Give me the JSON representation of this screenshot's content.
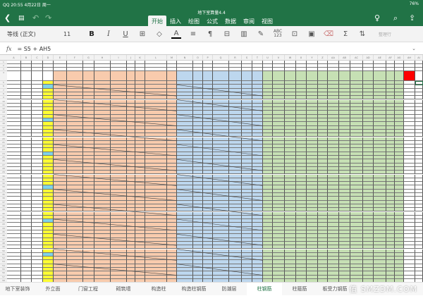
{
  "status_bar": {
    "left": "QQ 20:55 4月22日 周一",
    "right": "76%"
  },
  "window": {
    "title": "地下室算量4.4"
  },
  "ribbon": {
    "tabs": [
      "开始",
      "插入",
      "绘图",
      "公式",
      "数据",
      "审阅",
      "视图"
    ],
    "active": "开始"
  },
  "toolbar": {
    "font": "等线 (正文)",
    "size": "11",
    "bold": "B",
    "italic": "I",
    "underline": "U",
    "font_color": "A",
    "spell": "ABC\n123",
    "sum": "Σ",
    "more": "整理行"
  },
  "formula_bar": {
    "fx": "fx",
    "formula": "= S5 + AH5"
  },
  "colors": {
    "green": "#217346",
    "yellow": "#ffff33",
    "orange": "#f8cbad",
    "blue": "#bdd7ee",
    "lightgreen": "#c6e0b4",
    "red": "#ff0000"
  },
  "columns": [
    "A",
    "B",
    "C",
    "D",
    "E",
    "F",
    "G",
    "H",
    "I",
    "J",
    "K",
    "L",
    "M",
    "N",
    "O",
    "P",
    "Q",
    "R",
    "S",
    "T",
    "U",
    "V",
    "W",
    "X",
    "Y",
    "Z",
    "AA",
    "AB",
    "AC",
    "AD",
    "AE",
    "AF",
    "AG",
    "AH",
    "AI"
  ],
  "sheets": [
    "地下室装饰",
    "外立面",
    "门窗工程",
    "砌筑墙",
    "构造柱",
    "构造柱钢筋",
    "防潮层",
    "柱钢筋",
    "柱箍筋",
    "板受力钢筋"
  ],
  "active_sheet": "柱钢筋",
  "watermark": "值 什么值得买 SMZDM.COM"
}
